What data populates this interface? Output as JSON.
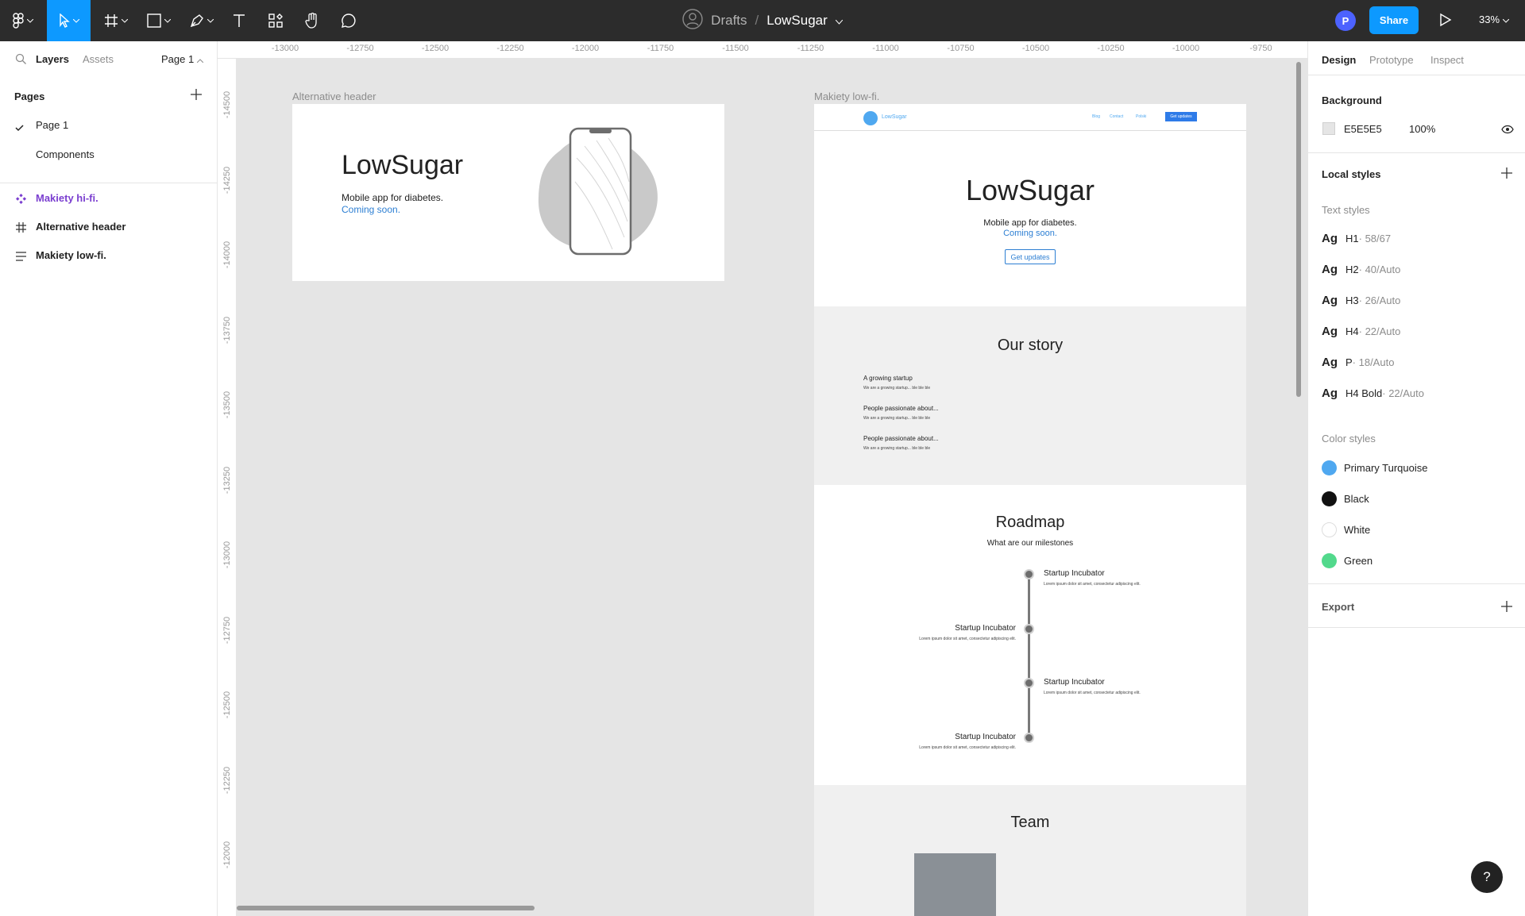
{
  "toolbar": {
    "tools": [
      "main-menu",
      "move",
      "frame",
      "shape",
      "pen",
      "text",
      "resources",
      "hand",
      "comment"
    ],
    "breadcrumb": {
      "folder": "Drafts",
      "separator": "/",
      "file": "LowSugar"
    },
    "avatar": "P",
    "share_label": "Share",
    "zoom": "33%"
  },
  "left_panel": {
    "tabs": {
      "layers": "Layers",
      "assets": "Assets",
      "page_select": "Page 1"
    },
    "pages_title": "Pages",
    "pages": [
      "Page 1",
      "Components"
    ],
    "layers": [
      {
        "label": "Makiety hi-fi.",
        "icon": "component-icon",
        "color": "#7b3fd0"
      },
      {
        "label": "Alternative header",
        "icon": "frame-hash-icon",
        "color": "#222222"
      },
      {
        "label": "Makiety low-fi.",
        "icon": "text-lines-icon",
        "color": "#222222"
      }
    ]
  },
  "rulers": {
    "top": [
      "-13000",
      "-12750",
      "-12500",
      "-12250",
      "-12000",
      "-11750",
      "-11500",
      "-11250",
      "-11000",
      "-10750",
      "-10500",
      "-10250",
      "-10000",
      "-9750"
    ],
    "left": [
      "-14500",
      "-14250",
      "-14000",
      "-13750",
      "-13500",
      "-13250",
      "-13000",
      "-12750",
      "-12500",
      "-12250",
      "-12000"
    ]
  },
  "canvas": {
    "background": "#E5E5E5",
    "alt_header": {
      "label": "Alternative header",
      "title": "LowSugar",
      "subtitle": "Mobile app for diabetes.",
      "coming": "Coming soon."
    },
    "lowfi": {
      "label": "Makiety low-fi.",
      "nav": {
        "brand": "LowSugar",
        "links": [
          "Blog",
          "Contact",
          "Polski"
        ],
        "cta": "Get updates"
      },
      "hero": {
        "title": "LowSugar",
        "subtitle": "Mobile app for diabetes.",
        "coming": "Coming soon.",
        "button": "Get updates"
      },
      "story": {
        "title": "Our story",
        "items": [
          {
            "heading": "A growing startup",
            "body": "We are a growing startup... ble ble ble"
          },
          {
            "heading": "People passionate about...",
            "body": "We are a growing startup... ble ble ble"
          },
          {
            "heading": "People passionate about...",
            "body": "We are a growing startup... ble ble ble"
          }
        ]
      },
      "roadmap": {
        "title": "Roadmap",
        "subtitle": "What are our milestones",
        "items": [
          {
            "heading": "Startup Incubator",
            "body": "Lorem ipsum dolor sit amet, consectetur adipiscing elit.",
            "side": "right"
          },
          {
            "heading": "Startup Incubator",
            "body": "Lorem ipsum dolor sit amet, consectetur adipiscing elit.",
            "side": "left"
          },
          {
            "heading": "Startup Incubator",
            "body": "Lorem ipsum dolor sit amet, consectetur adipiscing elit.",
            "side": "right"
          },
          {
            "heading": "Startup Incubator",
            "body": "Lorem ipsum dolor sit amet, consectetur adipiscing elit.",
            "side": "left"
          }
        ]
      },
      "team": {
        "title": "Team"
      }
    }
  },
  "right_panel": {
    "tabs": [
      "Design",
      "Prototype",
      "Inspect"
    ],
    "background": {
      "title": "Background",
      "hex": "E5E5E5",
      "opacity": "100%"
    },
    "local_styles": "Local styles",
    "text_styles_title": "Text styles",
    "text_styles": [
      {
        "ag": "Ag",
        "name": "H1",
        "meta": " · 58/67"
      },
      {
        "ag": "Ag",
        "name": "H2",
        "meta": " · 40/Auto"
      },
      {
        "ag": "Ag",
        "name": "H3",
        "meta": " · 26/Auto"
      },
      {
        "ag": "Ag",
        "name": "H4",
        "meta": " · 22/Auto"
      },
      {
        "ag": "Ag",
        "name": "P",
        "meta": " · 18/Auto"
      },
      {
        "ag": "Ag",
        "name": "H4 Bold",
        "meta": " · 22/Auto"
      }
    ],
    "color_styles_title": "Color styles",
    "color_styles": [
      {
        "name": "Primary Turquoise",
        "color": "#4fa8f0"
      },
      {
        "name": "Black",
        "color": "#111111"
      },
      {
        "name": "White",
        "color": "#ffffff"
      },
      {
        "name": "Green",
        "color": "#52d98c"
      }
    ],
    "export": "Export"
  },
  "help": "?"
}
